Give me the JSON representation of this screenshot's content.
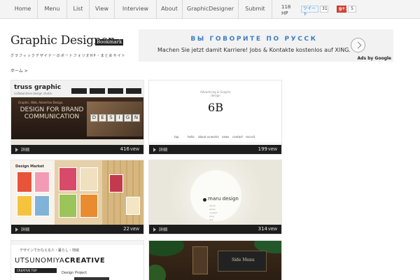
{
  "nav": {
    "items": [
      {
        "label": "Home"
      },
      {
        "label": "Menu"
      },
      {
        "label": "List"
      },
      {
        "label": "View"
      },
      {
        "label": "Interview"
      },
      {
        "label": "About"
      },
      {
        "label": "GraphicDesigner"
      },
      {
        "label": "Submit"
      }
    ],
    "hp_count": "118 HP",
    "tweet_label": "ツイート",
    "tweet_count": "31",
    "gplus_label": "g+1",
    "gplus_count": "5"
  },
  "header": {
    "logo_text": "Graphic Designer",
    "logo_tag": "Bookmark",
    "subtitle": "グラフィックデザイナーのポートフォリオHP・まとめサイト",
    "breadcrumb": "ホーム >"
  },
  "ad": {
    "line1": "ВЫ ГОВОРИТЕ ПО РУССК",
    "line2": "Machen Sie jetzt damit Karriere! Jobs & Kontakte kostenlos auf XING.",
    "by": "Ads by Google"
  },
  "colors": {
    "accent_blue": "#3c7ec4",
    "bar_dark": "#1d1d1d",
    "gplus_red": "#d34836"
  },
  "cards": [
    {
      "bar_label": "詳細",
      "views": "416",
      "view_unit": "VIEW",
      "thumb": {
        "brand": "truss graphic",
        "tagline": "collaborative design studio",
        "small_line": "Graphic, Web, Advertise Design.",
        "headline": "DESIGN FOR BRAND COMMUNICATION",
        "block_letters": [
          "D",
          "E",
          "S",
          "I",
          "G",
          "N"
        ]
      }
    },
    {
      "bar_label": "詳細",
      "views": "199",
      "view_unit": "VIEW",
      "thumb": {
        "small_lines": "Advertising & Graphic design",
        "logo": "6B",
        "nav": [
          "top",
          "hello",
          "about us",
          "works",
          "news",
          "contact",
          "recruit"
        ]
      }
    },
    {
      "bar_label": "詳細",
      "views": "22",
      "view_unit": "VIEW",
      "thumb": {
        "title": "Design Market"
      }
    },
    {
      "bar_label": "詳細",
      "views": "314",
      "view_unit": "VIEW",
      "thumb": {
        "name": "maru design",
        "menu": [
          "about",
          "works",
          "contact",
          "blog",
          "link"
        ]
      }
    },
    {
      "thumb": {
        "jp": "デザインでかなえる人・暮らし・地域",
        "main_light": "UTSUNOMIYA",
        "main_bold": "CREATIVE",
        "bar": "CREATIVE TOP",
        "project": "Design Project"
      }
    },
    {
      "thumb": {
        "card_text": "Side Menu"
      }
    }
  ]
}
